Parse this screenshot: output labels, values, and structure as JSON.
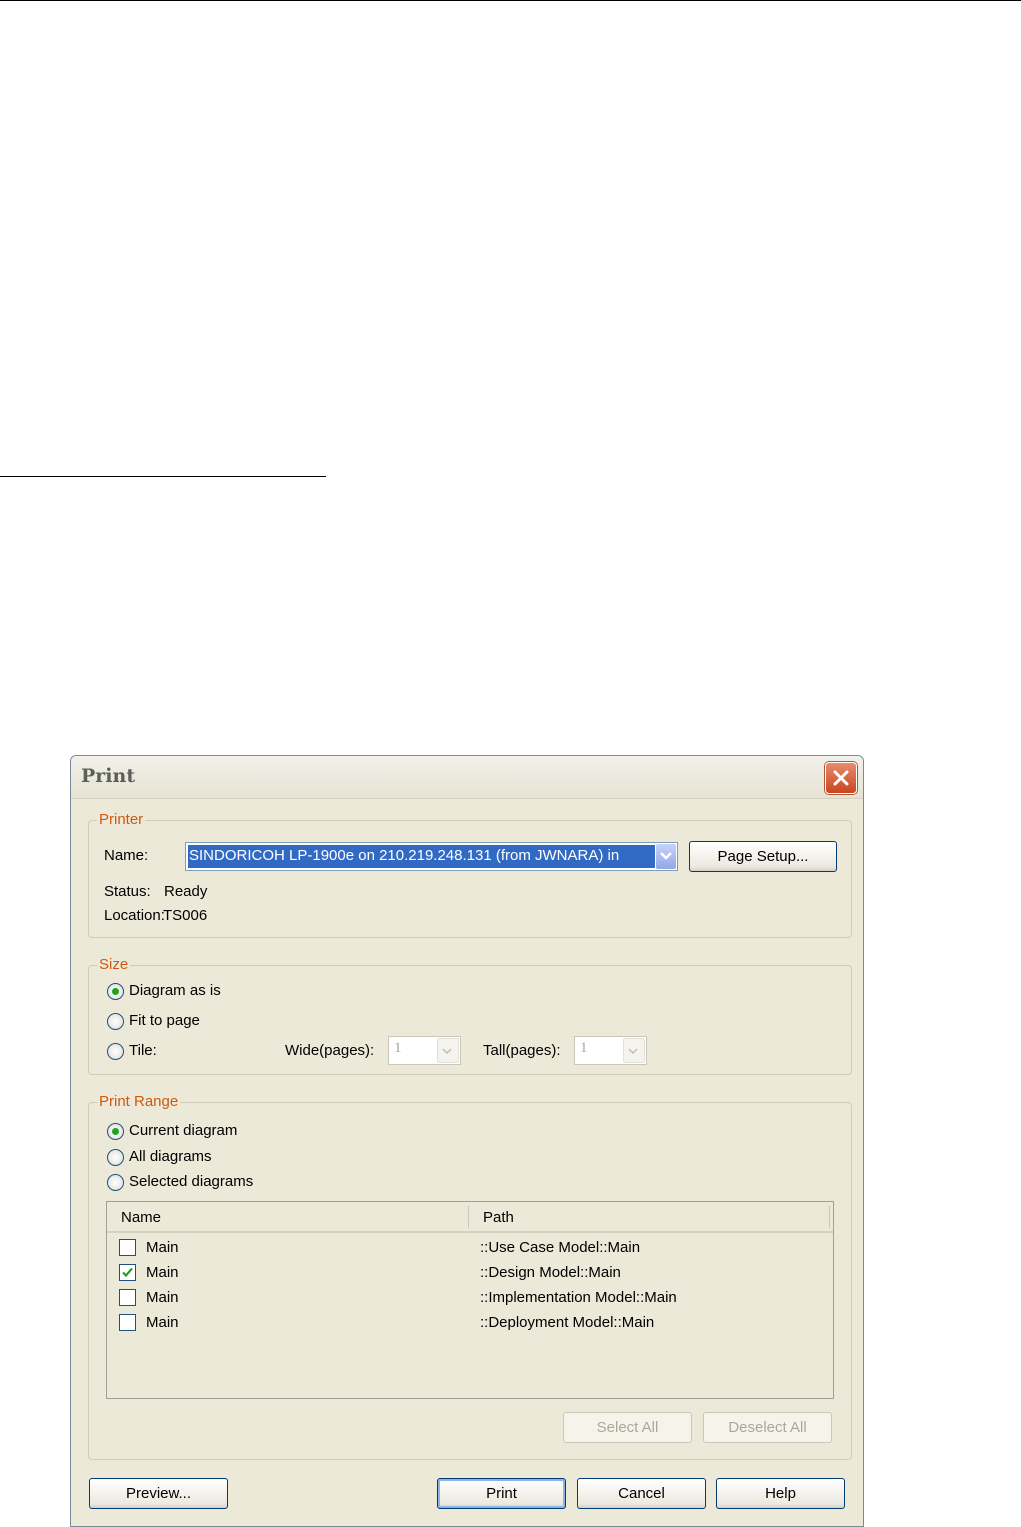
{
  "dialog": {
    "title": "Print",
    "printer": {
      "legend": "Printer",
      "name_label": "Name:",
      "name_value": "SINDORICOH LP-1900e on 210.219.248.131 (from JWNARA) in",
      "page_setup_label": "Page Setup...",
      "status_label": "Status:",
      "status_value": "Ready",
      "location_label": "Location:",
      "location_value": "TS006"
    },
    "size": {
      "legend": "Size",
      "options": [
        {
          "label": "Diagram as is",
          "selected": true
        },
        {
          "label": "Fit to page",
          "selected": false
        },
        {
          "label": "Tile:",
          "selected": false
        }
      ],
      "wide_label": "Wide(pages):",
      "wide_value": "1",
      "tall_label": "Tall(pages):",
      "tall_value": "1"
    },
    "range": {
      "legend": "Print Range",
      "options": [
        {
          "label": "Current diagram",
          "selected": true
        },
        {
          "label": "All diagrams",
          "selected": false
        },
        {
          "label": "Selected diagrams",
          "selected": false
        }
      ],
      "columns": [
        "Name",
        "Path"
      ],
      "rows": [
        {
          "name": "Main",
          "path": "::Use Case Model::Main",
          "checked": false
        },
        {
          "name": "Main",
          "path": "::Design Model::Main",
          "checked": true
        },
        {
          "name": "Main",
          "path": "::Implementation Model::Main",
          "checked": false
        },
        {
          "name": "Main",
          "path": "::Deployment Model::Main",
          "checked": false
        }
      ],
      "select_all_label": "Select All",
      "deselect_all_label": "Deselect All"
    },
    "buttons": {
      "preview": "Preview...",
      "print": "Print",
      "cancel": "Cancel",
      "help": "Help"
    }
  },
  "colors": {
    "accent": "#316ac5",
    "legend": "#cc5a10",
    "dialog_bg": "#ece9d8",
    "close": "#c8451f",
    "radio_dot": "#21a121"
  }
}
